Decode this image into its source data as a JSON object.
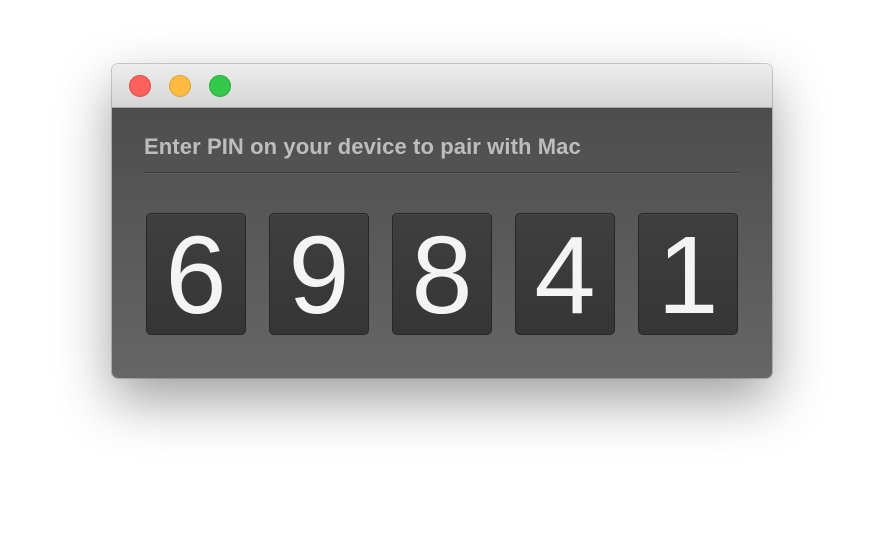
{
  "window": {
    "traffic_lights": {
      "close_color": "#fc615d",
      "minimize_color": "#fdbc40",
      "zoom_color": "#34c84a"
    }
  },
  "pairing": {
    "prompt": "Enter PIN on your device to pair with Mac",
    "pin_digits": [
      "6",
      "9",
      "8",
      "4",
      "1"
    ]
  }
}
